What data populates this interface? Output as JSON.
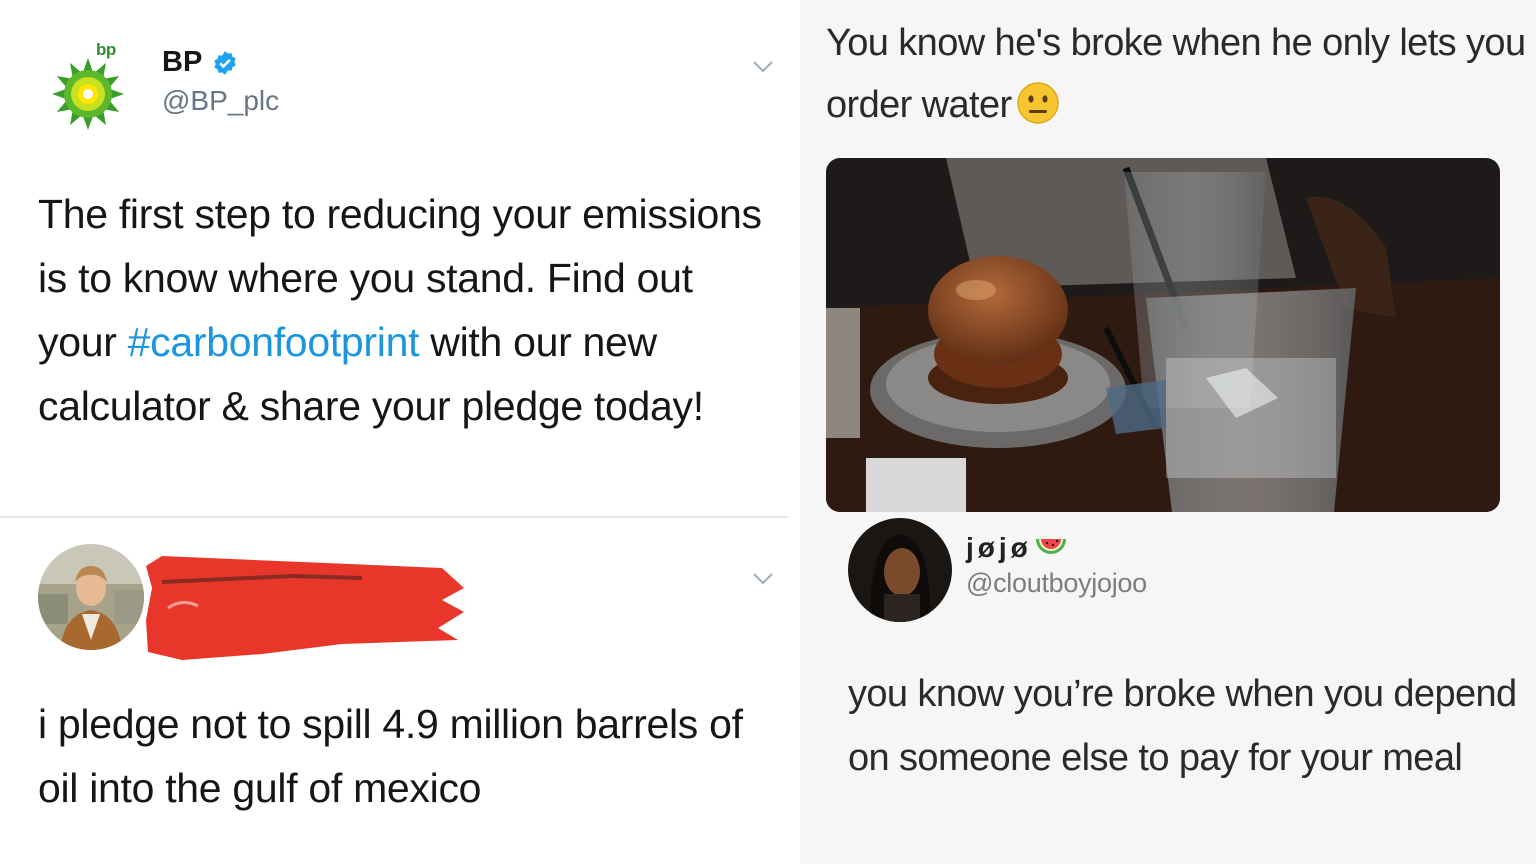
{
  "left_tweet": {
    "logo_text": "bp",
    "name": "BP",
    "handle": "@BP_plc",
    "text_before": "The first step to reducing your emissions is to know where you stand. Find out your ",
    "hashtag": "#carbonfootprint",
    "text_after": " with our new calculator & share your pledge today!"
  },
  "reply_tweet": {
    "text": "i pledge not to spill 4.9 million barrels of oil into the gulf of mexico"
  },
  "right_tweet": {
    "text": "You know he's broke when he only lets you order water",
    "emoji": "neutral-face-emoji"
  },
  "right_reply": {
    "name": "jøjø",
    "handle": "@cloutboyjojoo",
    "text": "you know you’re broke when you depend on someone else to pay for your meal"
  },
  "colors": {
    "hashtag": "#1b95e0",
    "verified": "#1da1f2",
    "redaction": "#e8372a"
  }
}
